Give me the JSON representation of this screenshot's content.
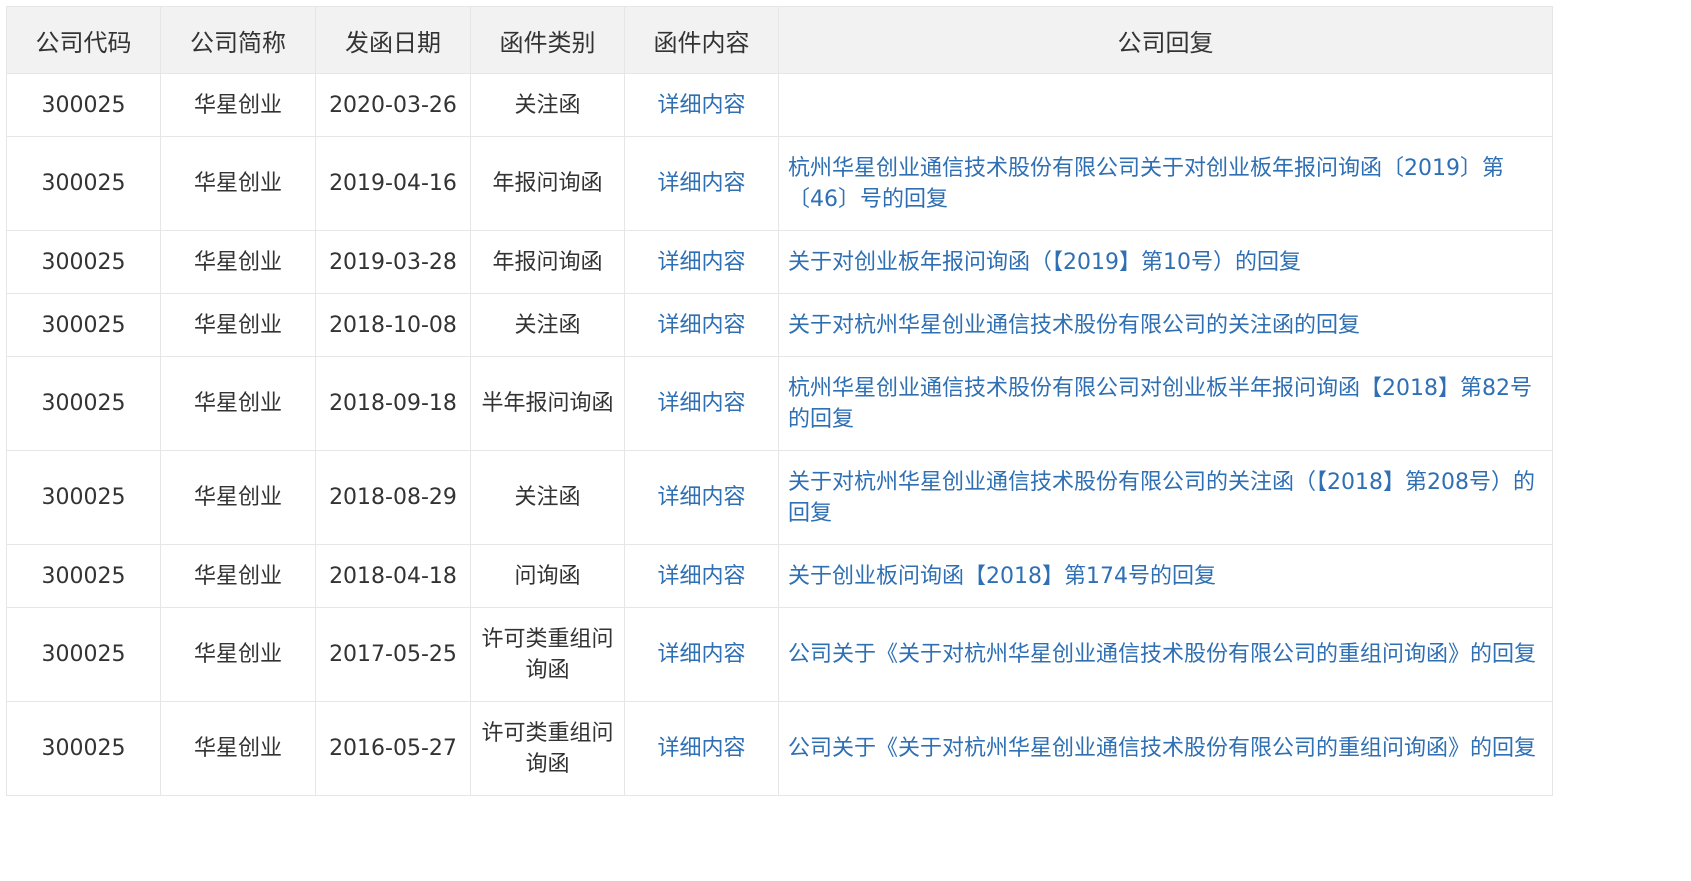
{
  "table": {
    "headers": [
      "公司代码",
      "公司简称",
      "发函日期",
      "函件类别",
      "函件内容",
      "公司回复"
    ],
    "rows": [
      {
        "code": "300025",
        "name": "华星创业",
        "date": "2020-03-26",
        "type": "关注函",
        "detail": "详细内容",
        "reply": ""
      },
      {
        "code": "300025",
        "name": "华星创业",
        "date": "2019-04-16",
        "type": "年报问询函",
        "detail": "详细内容",
        "reply": "杭州华星创业通信技术股份有限公司关于对创业板年报问询函〔2019〕第〔46〕号的回复"
      },
      {
        "code": "300025",
        "name": "华星创业",
        "date": "2019-03-28",
        "type": "年报问询函",
        "detail": "详细内容",
        "reply": "关于对创业板年报问询函（【2019】第10号）的回复"
      },
      {
        "code": "300025",
        "name": "华星创业",
        "date": "2018-10-08",
        "type": "关注函",
        "detail": "详细内容",
        "reply": "关于对杭州华星创业通信技术股份有限公司的关注函的回复"
      },
      {
        "code": "300025",
        "name": "华星创业",
        "date": "2018-09-18",
        "type": "半年报问询函",
        "detail": "详细内容",
        "reply": "杭州华星创业通信技术股份有限公司对创业板半年报问询函【2018】第82号的回复"
      },
      {
        "code": "300025",
        "name": "华星创业",
        "date": "2018-08-29",
        "type": "关注函",
        "detail": "详细内容",
        "reply": "关于对杭州华星创业通信技术股份有限公司的关注函（【2018】第208号）的回复"
      },
      {
        "code": "300025",
        "name": "华星创业",
        "date": "2018-04-18",
        "type": "问询函",
        "detail": "详细内容",
        "reply": "关于创业板问询函【2018】第174号的回复"
      },
      {
        "code": "300025",
        "name": "华星创业",
        "date": "2017-05-25",
        "type": "许可类重组问询函",
        "detail": "详细内容",
        "reply": "公司关于《关于对杭州华星创业通信技术股份有限公司的重组问询函》的回复"
      },
      {
        "code": "300025",
        "name": "华星创业",
        "date": "2016-05-27",
        "type": "许可类重组问询函",
        "detail": "详细内容",
        "reply": "公司关于《关于对杭州华星创业通信技术股份有限公司的重组问询函》的回复"
      }
    ]
  },
  "colors": {
    "header_bg": "#f2f2f2",
    "border": "#e6e6e6",
    "text": "#333333",
    "link": "#2f6fb3"
  }
}
